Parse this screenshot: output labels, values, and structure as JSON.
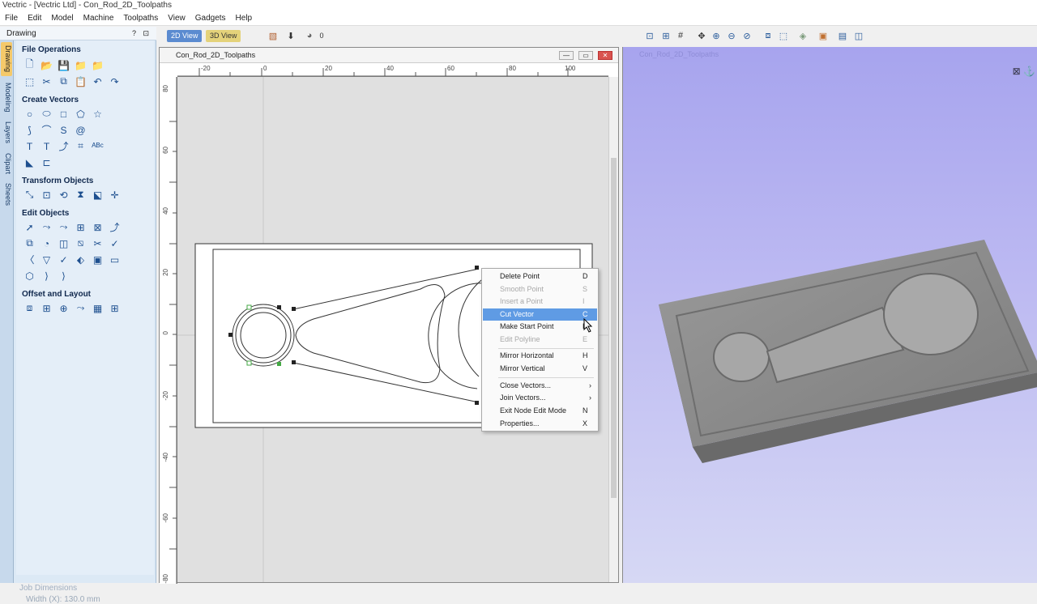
{
  "window": {
    "title": "Vectric - [Vectric Ltd] - Con_Rod_2D_Toolpaths"
  },
  "menu": [
    "File",
    "Edit",
    "Model",
    "Machine",
    "Toolpaths",
    "View",
    "Gadgets",
    "Help"
  ],
  "left_panel": {
    "header": "Drawing",
    "header_icons": "? ⊡",
    "side_tabs": [
      "Drawing",
      "Modeling",
      "Layers",
      "Clipart",
      "Sheets"
    ],
    "groups": {
      "file_operations": "File Operations",
      "create_vectors": "Create Vectors",
      "transform_objects": "Transform Objects",
      "edit_objects": "Edit Objects",
      "offset_layout": "Offset and Layout"
    },
    "job_dimensions": {
      "title": "Job Dimensions",
      "width_line": "Width  (X): 130.0 mm"
    }
  },
  "view_tabs": {
    "tab_2d": "2D View",
    "tab_3d": "3D View",
    "zoom_value": "0"
  },
  "doc": {
    "name_2d": "Con_Rod_2D_Toolpaths",
    "name_3d": "Con_Rod_2D_Toolpaths"
  },
  "rulers": {
    "h": [
      "-20",
      "0",
      "20",
      "40",
      "60",
      "80",
      "100"
    ],
    "v": [
      "80",
      "60",
      "40",
      "20",
      "0",
      "-20",
      "-40",
      "-60",
      "-80"
    ]
  },
  "context_menu": {
    "items": [
      {
        "label": "Delete Point",
        "key": "D"
      },
      {
        "label": "Smooth Point",
        "key": "S"
      },
      {
        "label": "Insert a Point",
        "key": "I"
      },
      {
        "label": "Cut Vector",
        "key": "C"
      },
      {
        "label": "Make Start Point",
        "key": "P"
      },
      {
        "label": "Edit Polyline",
        "key": "E"
      },
      {
        "label": "Mirror Horizontal",
        "key": "H"
      },
      {
        "label": "Mirror Vertical",
        "key": "V"
      },
      {
        "label": "Close Vectors...",
        "key": "›"
      },
      {
        "label": "Join Vectors...",
        "key": "›"
      },
      {
        "label": "Exit Node Edit Mode",
        "key": "N"
      },
      {
        "label": "Properties...",
        "key": "X"
      }
    ]
  },
  "colors": {
    "highlight": "#5f9be4",
    "panel": "#dce9f5",
    "bg3d_top": "#a7a4ee"
  }
}
